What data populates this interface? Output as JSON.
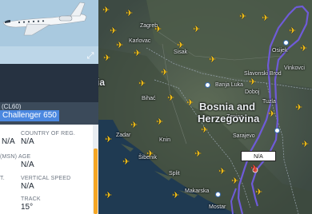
{
  "panel": {
    "type_code": "(CL60)",
    "type_name": "Challenger 650",
    "labels": {
      "country": "COUNTRY OF REG.",
      "age": "(MSN) AGE",
      "vspeed": "VERTICAL SPEED",
      "track": "TRACK"
    },
    "values": {
      "left1": "N/A",
      "country": "N/A",
      "age": "N/A",
      "vspeed": "N/A",
      "track": "15°"
    },
    "frag_t": "T."
  },
  "map": {
    "cities": [
      "Zagreb",
      "Osijek",
      "Slavonski Brod",
      "Banja Luka",
      "Bihać",
      "Split",
      "Makarska",
      "Mostar",
      "Sarajevo",
      "Tuzla",
      "Zenica",
      "Doboj",
      "Vinkovci",
      "Knin",
      "Zadar",
      "Šibenik",
      "Karlovac",
      "Sisak"
    ],
    "country_bosnia": "Bosnia and",
    "country_herz": "Herzegovina",
    "country_croatia_frag": "ia",
    "flight_label": "N/A",
    "colors": {
      "track": "#6f5bd8",
      "plane": "#f6c21a",
      "accent": "#4b88e0"
    }
  },
  "photo": {
    "expand_icon": "expand-icon"
  }
}
